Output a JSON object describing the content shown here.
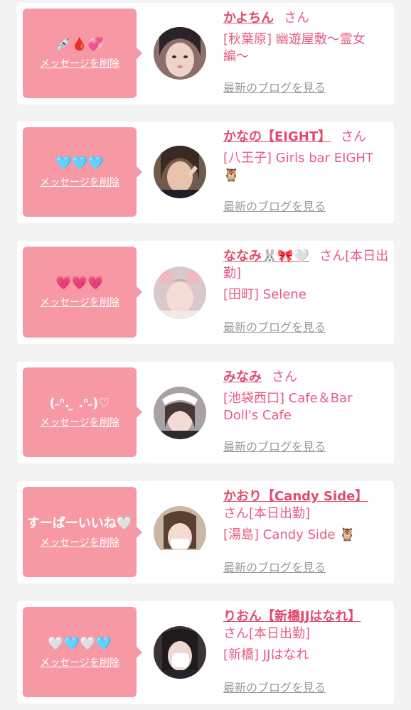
{
  "delete_label": "メッセージを削除",
  "blog_label": "最新のブログを見る",
  "accent_color": "#f799a5",
  "name_color": "#e24a6e",
  "cards": [
    {
      "message": "💉🩸💞",
      "name": "かよちん",
      "san": "さん",
      "shop": "[秋葉原] 幽遊屋敷〜霊女編〜"
    },
    {
      "message": "🩵🩵🩵",
      "name": "かなの【EIGHT】",
      "san": "さん",
      "shop": "[八王子] Girls bar EIGHT 🦉"
    },
    {
      "message": "💗💗💗",
      "name": "ななみ🐰🎀🤍",
      "san": "さん[本日出勤]",
      "shop": "[田町] Selene"
    },
    {
      "message": "(˶ᐢ. ̫ .ᐢ˶)♡",
      "name": "みなみ",
      "san": "さん",
      "shop": "[池袋西口] Cafe＆Bar Doll's Cafe"
    },
    {
      "message": "すーぱーいいね🤍",
      "name": "かおり【Candy Side】",
      "san": "さん[本日出勤]",
      "shop": "[湯島] Candy Side 🦉"
    },
    {
      "message": "🤍🩵🤍🩵",
      "name": "りおん【新橋JJはなれ】",
      "san": "さん[本日出勤]",
      "shop": "[新橋] JJはなれ"
    }
  ]
}
